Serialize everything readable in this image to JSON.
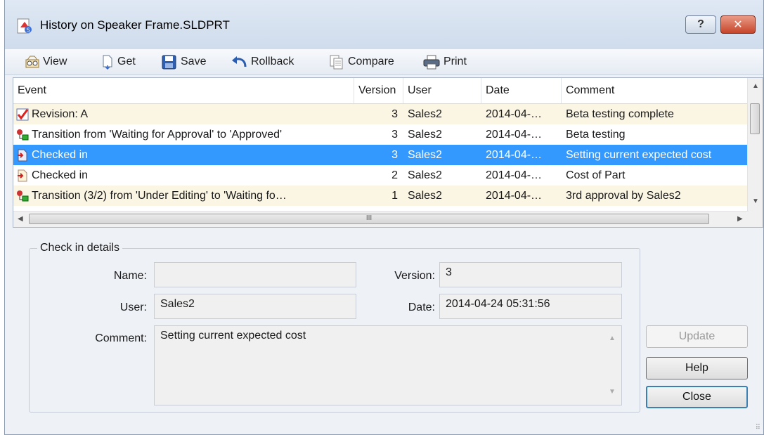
{
  "window": {
    "title": "History on Speaker Frame.SLDPRT",
    "help_glyph": "?",
    "close_glyph": "✕"
  },
  "toolbar": {
    "view": "View",
    "get": "Get",
    "save": "Save",
    "rollback": "Rollback",
    "compare": "Compare",
    "print": "Print"
  },
  "grid": {
    "columns": [
      "Event",
      "Version",
      "User",
      "Date",
      "Comment"
    ],
    "rows": [
      {
        "event": "Revision: A",
        "version": "3",
        "user": "Sales2",
        "date": "2014-04-…",
        "comment": "Beta testing complete",
        "icon": "revision-check-icon"
      },
      {
        "event": "Transition from 'Waiting for Approval' to 'Approved'",
        "version": "3",
        "user": "Sales2",
        "date": "2014-04-…",
        "comment": "Beta testing",
        "icon": "transition-icon"
      },
      {
        "event": "Checked in",
        "version": "3",
        "user": "Sales2",
        "date": "2014-04-…",
        "comment": "Setting current expected cost",
        "icon": "checked-in-icon"
      },
      {
        "event": "Checked in",
        "version": "2",
        "user": "Sales2",
        "date": "2014-04-…",
        "comment": "Cost of Part",
        "icon": "checked-in-icon"
      },
      {
        "event": "Transition (3/2) from 'Under Editing' to 'Waiting fo…",
        "version": "1",
        "user": "Sales2",
        "date": "2014-04-…",
        "comment": "3rd approval by Sales2",
        "icon": "transition-icon"
      }
    ],
    "selected_row": 2,
    "hscroll_grip": "III"
  },
  "details": {
    "group_title": "Check in details",
    "name_label": "Name:",
    "name_value": "",
    "version_label": "Version:",
    "version_value": "3",
    "user_label": "User:",
    "user_value": "Sales2",
    "date_label": "Date:",
    "date_value": "2014-04-24 05:31:56",
    "comment_label": "Comment:",
    "comment_value": "Setting current expected cost"
  },
  "buttons": {
    "update": "Update",
    "help": "Help",
    "close": "Close"
  },
  "colors": {
    "selection": "#3399ff",
    "row_alt": "#fbf5e4",
    "close_button": "#c6452a"
  }
}
